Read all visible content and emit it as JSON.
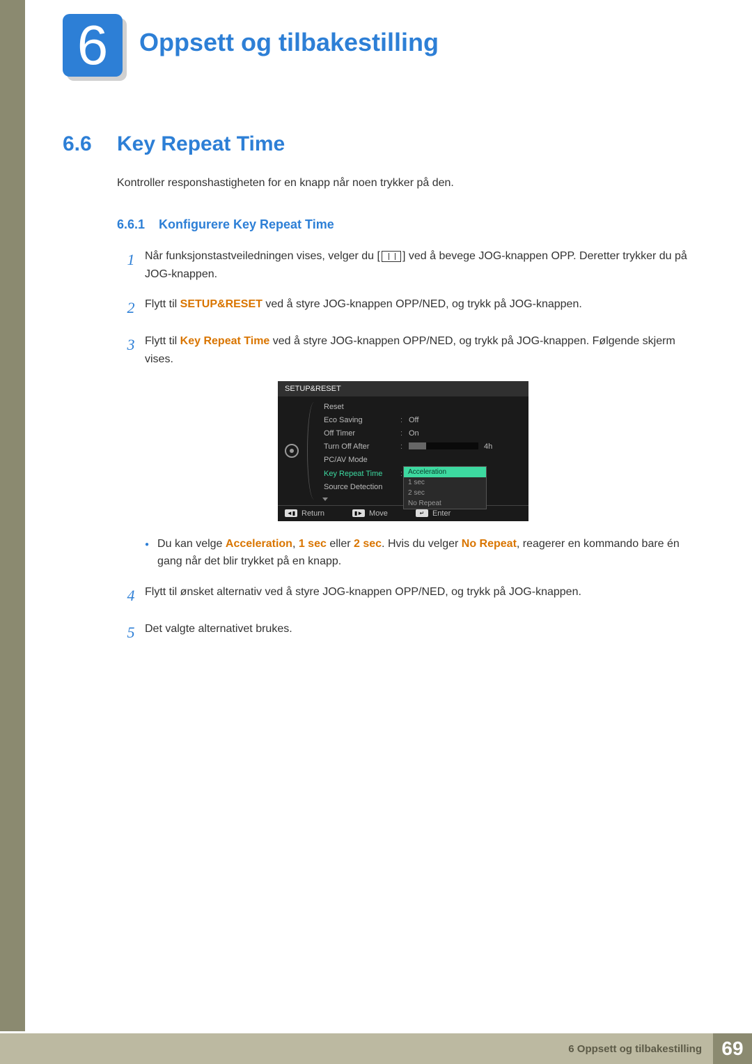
{
  "chapter": {
    "number": "6",
    "title": "Oppsett og tilbakestilling"
  },
  "section": {
    "number": "6.6",
    "title": "Key Repeat Time"
  },
  "intro": "Kontroller responshastigheten for en knapp når noen trykker på den.",
  "subsection": {
    "number": "6.6.1",
    "title": "Konfigurere Key Repeat Time"
  },
  "steps": {
    "s1_a": "Når funksjonstastveiledningen vises, velger du [",
    "s1_b": "] ved å bevege JOG-knappen OPP. Deretter trykker du på JOG-knappen.",
    "s2_a": "Flytt til ",
    "s2_b": "SETUP&RESET",
    "s2_c": " ved å styre JOG-knappen OPP/NED, og trykk på JOG-knappen.",
    "s3_a": "Flytt til ",
    "s3_b": "Key Repeat Time",
    "s3_c": " ved å styre JOG-knappen OPP/NED, og trykk på JOG-knappen. Følgende skjerm vises.",
    "bullet_a": "Du kan velge ",
    "bullet_accel": "Acceleration",
    "bullet_comma": ", ",
    "bullet_1sec": "1 sec",
    "bullet_or": " eller ",
    "bullet_2sec": "2 sec",
    "bullet_mid": ". Hvis du velger ",
    "bullet_norepeat": "No Repeat",
    "bullet_end": ", reagerer en kommando bare én gang når det blir trykket på en knapp.",
    "s4": "Flytt til ønsket alternativ ved å styre JOG-knappen OPP/NED, og trykk på JOG-knappen.",
    "s5": "Det valgte alternativet brukes."
  },
  "osd": {
    "header": "SETUP&RESET",
    "rows": {
      "reset": "Reset",
      "eco": "Eco Saving",
      "eco_val": "Off",
      "offtimer": "Off Timer",
      "offtimer_val": "On",
      "turnoff": "Turn Off After",
      "turnoff_val": "4h",
      "pcav": "PC/AV Mode",
      "keyrepeat": "Key Repeat Time",
      "source": "Source Detection"
    },
    "dropdown": [
      "Acceleration",
      "1 sec",
      "2 sec",
      "No Repeat"
    ],
    "footer": {
      "return": "Return",
      "move": "Move",
      "enter": "Enter"
    }
  },
  "nums": {
    "n1": "1",
    "n2": "2",
    "n3": "3",
    "n4": "4",
    "n5": "5"
  },
  "footer": {
    "label": "6 Oppsett og tilbakestilling",
    "page": "69"
  }
}
